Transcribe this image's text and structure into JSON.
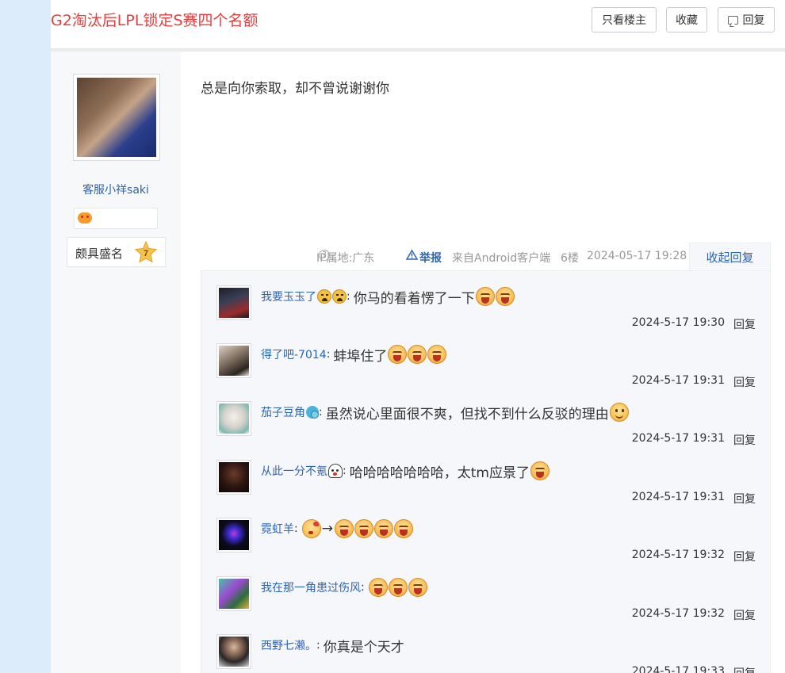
{
  "header": {
    "title": "G2淘汰后LPL锁定S赛四个名额",
    "buttons": {
      "only_op": "只看楼主",
      "favorite": "收藏",
      "reply": "回复"
    }
  },
  "author": {
    "name": "客服小祥saki",
    "level_title": "颇具盛名",
    "level": "7"
  },
  "post": {
    "text": "总是向你索取，却不曾说谢谢你",
    "ip_location": "IP属地:广东",
    "help_glyph": "?",
    "report_label": "举报",
    "client": "来自Android客户端",
    "floor": "6楼",
    "datetime": "2024-05-17 19:28",
    "collapse_label": "收起回复"
  },
  "replies": [
    {
      "user": "我要玉玉了",
      "text": "你马的看着愣了一下",
      "name_emojis": [
        "sad-face-emoji",
        "sad-face-emoji"
      ],
      "trailing_emojis": [
        "laughing-emoji",
        "laughing-emoji"
      ],
      "time": "2024-5-17 19:30",
      "reply_label": "回复"
    },
    {
      "user": "得了吧-7014",
      "text": "蚌埠住了",
      "name_emojis": [],
      "trailing_emojis": [
        "laughing-emoji",
        "laughing-emoji",
        "laughing-emoji"
      ],
      "time": "2024-5-17 19:31",
      "reply_label": "回复"
    },
    {
      "user": "茄子豆角",
      "text": "虽然说心里面很不爽，但找不到什么反驳的理由",
      "name_emojis": [
        "bubble-emoji"
      ],
      "trailing_emojis": [
        "smile-emoji"
      ],
      "time": "2024-5-17 19:31",
      "reply_label": "回复"
    },
    {
      "user": "从此一分不氪",
      "text": "哈哈哈哈哈哈哈，太tm应景了",
      "name_emojis": [
        "ghost-emoji"
      ],
      "trailing_emojis": [
        "laughing-emoji"
      ],
      "time": "2024-5-17 19:31",
      "reply_label": "回复"
    },
    {
      "user": "霓虹羊",
      "text": "",
      "arrow": "→",
      "name_emojis": [],
      "leading_emojis": [
        "wink-emoji"
      ],
      "trailing_emojis": [
        "laughing-emoji",
        "laughing-emoji",
        "laughing-emoji",
        "laughing-emoji"
      ],
      "time": "2024-5-17 19:32",
      "reply_label": "回复"
    },
    {
      "user": "我在那一角患过伤风",
      "text": "",
      "name_emojis": [],
      "trailing_emojis": [
        "laughing-emoji",
        "laughing-emoji",
        "laughing-emoji"
      ],
      "time": "2024-5-17 19:32",
      "reply_label": "回复"
    },
    {
      "user": "西野七濑。",
      "text": "你真是个天才",
      "name_emojis": [],
      "trailing_emojis": [],
      "time": "2024-5-17 19:33",
      "reply_label": "回复"
    }
  ],
  "colors": {
    "title_red": "#e53e3e",
    "link_blue": "#2d64b3",
    "page_bg_strip": "#dcecfb"
  }
}
